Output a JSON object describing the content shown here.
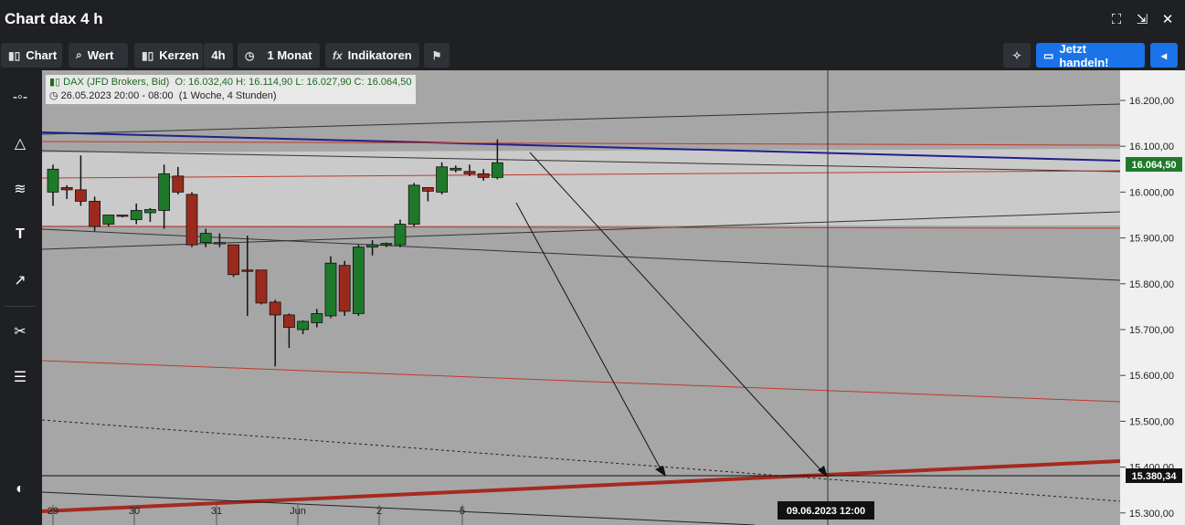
{
  "window": {
    "title": "Chart dax 4 h"
  },
  "toolbar": {
    "chart_label": "Chart",
    "wert_label": "Wert",
    "kerzen_label": "Kerzen",
    "interval_label": "4h",
    "range_label": "1 Monat",
    "indikatoren_label": "Indikatoren",
    "trade_label": "Jetzt handeln!"
  },
  "legend": {
    "instrument": "DAX (JFD Brokers, Bid)",
    "ohlc": "O: 16.032,40  H: 16.114,90  L: 16.027,90  C: 16.064,50",
    "range": "26.05.2023 20:00 - 08:00",
    "span": "(1 Woche, 4 Stunden)"
  },
  "colors": {
    "up": "#1e7a2a",
    "down": "#9b2a1e",
    "bg_dark": "#a6a6a6",
    "bg_light": "#c8c8c8",
    "price_badge": "#1e7a2a",
    "accent": "#1a73e8"
  },
  "chart_data": {
    "type": "candlestick",
    "ylim": [
      15280,
      16240
    ],
    "y_ticks": [
      "16.200,00",
      "16.100,00",
      "16.000,00",
      "15.900,00",
      "15.800,00",
      "15.700,00",
      "15.600,00",
      "15.500,00",
      "15.400,00",
      "15.300,00"
    ],
    "y_tick_values": [
      16200,
      16100,
      16000,
      15900,
      15800,
      15700,
      15600,
      15500,
      15400,
      15300
    ],
    "x_labels": [
      "29",
      "30",
      "31",
      "Jun",
      "2",
      "5"
    ],
    "last_price_label": "16.064,50",
    "crosshair_price_label": "15.380,34",
    "crosshair_time_label": "09.06.2023 12:00",
    "candles": [
      {
        "o": 16000,
        "h": 16060,
        "l": 15970,
        "c": 16050
      },
      {
        "o": 16010,
        "h": 16015,
        "l": 15985,
        "c": 16005
      },
      {
        "o": 16005,
        "h": 16080,
        "l": 15970,
        "c": 15980
      },
      {
        "o": 15980,
        "h": 15990,
        "l": 15915,
        "c": 15925
      },
      {
        "o": 15930,
        "h": 15950,
        "l": 15925,
        "c": 15950
      },
      {
        "o": 15950,
        "h": 15950,
        "l": 15945,
        "c": 15948
      },
      {
        "o": 15940,
        "h": 15975,
        "l": 15930,
        "c": 15960
      },
      {
        "o": 15955,
        "h": 15965,
        "l": 15935,
        "c": 15962
      },
      {
        "o": 15960,
        "h": 16060,
        "l": 15920,
        "c": 16040
      },
      {
        "o": 16035,
        "h": 16055,
        "l": 15995,
        "c": 16000
      },
      {
        "o": 15995,
        "h": 16000,
        "l": 15880,
        "c": 15885
      },
      {
        "o": 15890,
        "h": 15920,
        "l": 15880,
        "c": 15910
      },
      {
        "o": 15888,
        "h": 15910,
        "l": 15880,
        "c": 15890
      },
      {
        "o": 15885,
        "h": 15885,
        "l": 15815,
        "c": 15820
      },
      {
        "o": 15830,
        "h": 15905,
        "l": 15730,
        "c": 15828
      },
      {
        "o": 15830,
        "h": 15830,
        "l": 15755,
        "c": 15758
      },
      {
        "o": 15760,
        "h": 15765,
        "l": 15620,
        "c": 15732
      },
      {
        "o": 15732,
        "h": 15735,
        "l": 15660,
        "c": 15705
      },
      {
        "o": 15700,
        "h": 15720,
        "l": 15690,
        "c": 15718
      },
      {
        "o": 15715,
        "h": 15745,
        "l": 15705,
        "c": 15735
      },
      {
        "o": 15730,
        "h": 15860,
        "l": 15725,
        "c": 15845
      },
      {
        "o": 15840,
        "h": 15850,
        "l": 15730,
        "c": 15740
      },
      {
        "o": 15735,
        "h": 15885,
        "l": 15730,
        "c": 15880
      },
      {
        "o": 15880,
        "h": 15895,
        "l": 15862,
        "c": 15885
      },
      {
        "o": 15885,
        "h": 15890,
        "l": 15880,
        "c": 15888
      },
      {
        "o": 15885,
        "h": 15940,
        "l": 15880,
        "c": 15930
      },
      {
        "o": 15930,
        "h": 16020,
        "l": 15925,
        "c": 16015
      },
      {
        "o": 16010,
        "h": 16010,
        "l": 15980,
        "c": 16002
      },
      {
        "o": 16000,
        "h": 16065,
        "l": 15995,
        "c": 16055
      },
      {
        "o": 16048,
        "h": 16058,
        "l": 16043,
        "c": 16052
      },
      {
        "o": 16045,
        "h": 16060,
        "l": 16035,
        "c": 16040
      },
      {
        "o": 16040,
        "h": 16050,
        "l": 16025,
        "c": 16032
      },
      {
        "o": 16032,
        "h": 16115,
        "l": 16028,
        "c": 16064
      }
    ]
  }
}
